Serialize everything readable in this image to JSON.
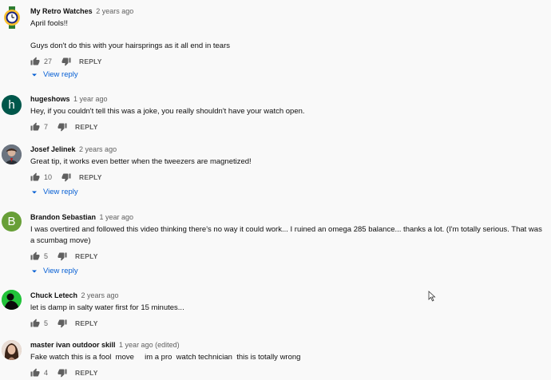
{
  "comments": [
    {
      "author": "My Retro Watches",
      "time": "2 years ago",
      "text": "April fools!!\n\nGuys don't do this with your hairsprings as it all end in tears",
      "likes": "27",
      "reply_label": "REPLY",
      "avatar_kind": "logo",
      "view_replies": "View reply"
    },
    {
      "author": "hugeshows",
      "time": "1 year ago",
      "text": "Hey, if you couldn't tell this was a joke, you really shouldn't have your watch open.",
      "likes": "7",
      "reply_label": "REPLY",
      "avatar_letter": "h",
      "avatar_color": "#00574b"
    },
    {
      "author": "Josef Jelinek",
      "time": "2 years ago",
      "text": "Great tip, it works even better when the tweezers are magnetized!",
      "likes": "10",
      "reply_label": "REPLY",
      "avatar_kind": "photo",
      "view_replies": "View reply"
    },
    {
      "author": "Brandon Sebastian",
      "time": "1 year ago",
      "text": "I was overtired and followed this video thinking there's no way it could work... I ruined an omega 285 balance... thanks a lot. (I'm totally serious. That was a scumbag move)",
      "likes": "5",
      "reply_label": "REPLY",
      "avatar_letter": "B",
      "avatar_color": "#689f38",
      "view_replies": "View reply"
    },
    {
      "author": "Chuck Letech",
      "time": "2 years ago",
      "text": "let is damp in salty water first for 15 minutes...",
      "likes": "5",
      "reply_label": "REPLY",
      "avatar_kind": "photo-green"
    },
    {
      "author": "master ivan outdoor skill",
      "time": "1 year ago (edited)",
      "text": "Fake watch this is a fool  move     im a pro  watch technician  this is totally wrong",
      "likes": "4",
      "reply_label": "REPLY",
      "avatar_kind": "photo-face"
    }
  ],
  "icons": {
    "like": "thumb-up-icon",
    "dislike": "thumb-down-icon",
    "expand": "chevron-down-icon"
  },
  "colors": {
    "link": "#065fd4",
    "meta": "#606060"
  }
}
